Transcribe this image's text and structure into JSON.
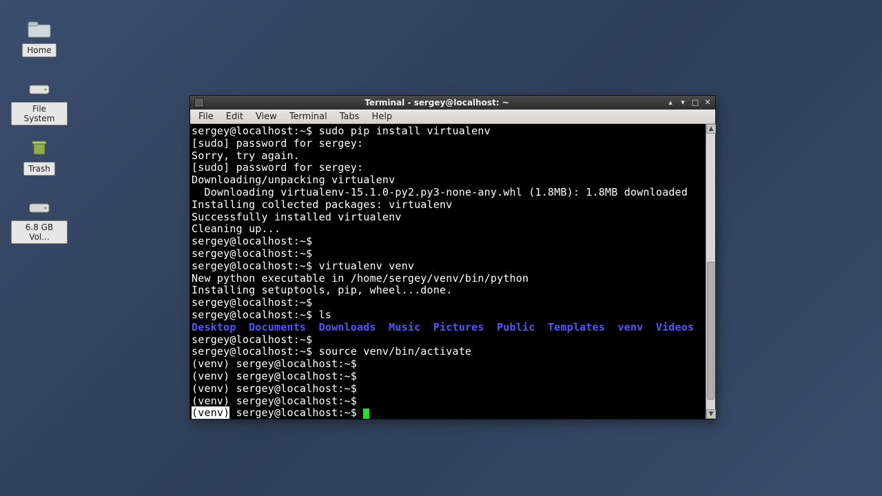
{
  "desktop": {
    "icons": [
      {
        "label": "Home"
      },
      {
        "label": "File System"
      },
      {
        "label": "Trash"
      },
      {
        "label": "6.8 GB Vol..."
      }
    ]
  },
  "window": {
    "title": "Terminal - sergey@localhost: ~",
    "menu": [
      "File",
      "Edit",
      "View",
      "Terminal",
      "Tabs",
      "Help"
    ],
    "controls": {
      "roll": "▴",
      "min": "▾",
      "max": "□",
      "close": "✕"
    }
  },
  "terminal": {
    "prompt": "sergey@localhost:~$",
    "venv_prompt": "(venv) sergey@localhost:~$",
    "lines": {
      "l1_cmd": " sudo pip install virtualenv",
      "l2": "[sudo] password for sergey:",
      "l3": "Sorry, try again.",
      "l4": "[sudo] password for sergey:",
      "l5": "Downloading/unpacking virtualenv",
      "l6": "  Downloading virtualenv-15.1.0-py2.py3-none-any.whl (1.8MB): 1.8MB downloaded",
      "l7": "Installing collected packages: virtualenv",
      "l8": "Successfully installed virtualenv",
      "l9": "Cleaning up...",
      "l12_cmd": " virtualenv venv",
      "l13": "New python executable in /home/sergey/venv/bin/python",
      "l14": "Installing setuptools, pip, wheel...done.",
      "l16_cmd": " ls",
      "dirs": "Desktop  Documents  Downloads  Music  Pictures  Public  Templates  venv  Videos",
      "l19_cmd": " source venv/bin/activate",
      "venv_open": "(venv)",
      "venv_rest": " sergey@localhost:~$ "
    }
  }
}
